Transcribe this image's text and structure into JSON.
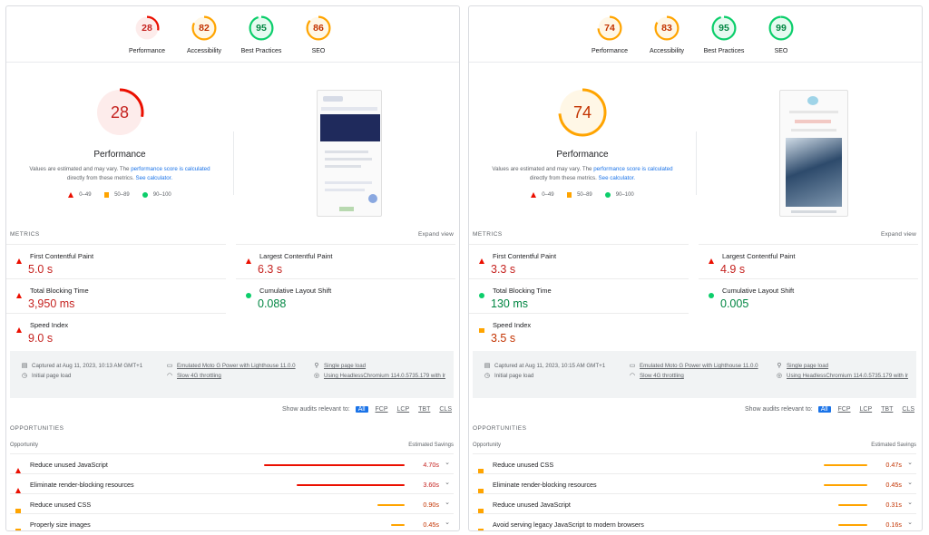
{
  "panels": [
    {
      "gauges": [
        {
          "label": "Performance",
          "score": "28",
          "value": 28,
          "color": "#eb0f00",
          "bg": "#fdeceb",
          "text": "#c5221f"
        },
        {
          "label": "Accessibility",
          "score": "82",
          "value": 82,
          "color": "#ffa400",
          "bg": "#fff7e6",
          "text": "#c33300"
        },
        {
          "label": "Best Practices",
          "score": "95",
          "value": 95,
          "color": "#0cce6b",
          "bg": "#e6faf0",
          "text": "#018642"
        },
        {
          "label": "SEO",
          "score": "86",
          "value": 86,
          "color": "#ffa400",
          "bg": "#fff7e6",
          "text": "#c33300"
        }
      ],
      "main": {
        "score": "28",
        "value": 28,
        "color": "#eb0f00",
        "bg": "#fdeceb",
        "text": "#c5221f",
        "title": "Performance"
      },
      "metrics": [
        {
          "name": "First Contentful Paint",
          "value": "5.0 s",
          "status": "red"
        },
        {
          "name": "Largest Contentful Paint",
          "value": "6.3 s",
          "status": "red"
        },
        {
          "name": "Total Blocking Time",
          "value": "3,950 ms",
          "status": "red"
        },
        {
          "name": "Cumulative Layout Shift",
          "value": "0.088",
          "status": "green"
        },
        {
          "name": "Speed Index",
          "value": "9.0 s",
          "status": "red"
        }
      ],
      "info": {
        "captured": "Captured at Aug 11, 2023, 10:13 AM GMT+1",
        "initial": "Initial page load",
        "device": "Emulated Moto G Power with Lighthouse 11.0.0",
        "throttle": "Slow 4G throttling",
        "single": "Single page load",
        "browser": "Using HeadlessChromium 114.0.5735.179 with lr"
      },
      "opportunities": [
        {
          "name": "Reduce unused JavaScript",
          "savings": "4.70s",
          "seconds": 4.7,
          "status": "red"
        },
        {
          "name": "Eliminate render-blocking resources",
          "savings": "3.60s",
          "seconds": 3.6,
          "status": "red"
        },
        {
          "name": "Reduce unused CSS",
          "savings": "0.90s",
          "seconds": 0.9,
          "status": "orange"
        },
        {
          "name": "Properly size images",
          "savings": "0.45s",
          "seconds": 0.45,
          "status": "orange"
        }
      ]
    },
    {
      "gauges": [
        {
          "label": "Performance",
          "score": "74",
          "value": 74,
          "color": "#ffa400",
          "bg": "#fff7e6",
          "text": "#c33300"
        },
        {
          "label": "Accessibility",
          "score": "83",
          "value": 83,
          "color": "#ffa400",
          "bg": "#fff7e6",
          "text": "#c33300"
        },
        {
          "label": "Best Practices",
          "score": "95",
          "value": 95,
          "color": "#0cce6b",
          "bg": "#e6faf0",
          "text": "#018642"
        },
        {
          "label": "SEO",
          "score": "99",
          "value": 99,
          "color": "#0cce6b",
          "bg": "#e6faf0",
          "text": "#018642"
        }
      ],
      "main": {
        "score": "74",
        "value": 74,
        "color": "#ffa400",
        "bg": "#fff7e6",
        "text": "#c33300",
        "title": "Performance"
      },
      "metrics": [
        {
          "name": "First Contentful Paint",
          "value": "3.3 s",
          "status": "red"
        },
        {
          "name": "Largest Contentful Paint",
          "value": "4.9 s",
          "status": "red"
        },
        {
          "name": "Total Blocking Time",
          "value": "130 ms",
          "status": "green"
        },
        {
          "name": "Cumulative Layout Shift",
          "value": "0.005",
          "status": "green"
        },
        {
          "name": "Speed Index",
          "value": "3.5 s",
          "status": "orange"
        }
      ],
      "info": {
        "captured": "Captured at Aug 11, 2023, 10:15 AM GMT+1",
        "initial": "Initial page load",
        "device": "Emulated Moto G Power with Lighthouse 11.0.0",
        "throttle": "Slow 4G throttling",
        "single": "Single page load",
        "browser": "Using HeadlessChromium 114.0.5735.179 with lr"
      },
      "opportunities": [
        {
          "name": "Reduce unused CSS",
          "savings": "0.47s",
          "seconds": 0.47,
          "status": "orange"
        },
        {
          "name": "Eliminate render-blocking resources",
          "savings": "0.45s",
          "seconds": 0.45,
          "status": "orange"
        },
        {
          "name": "Reduce unused JavaScript",
          "savings": "0.31s",
          "seconds": 0.31,
          "status": "orange"
        },
        {
          "name": "Avoid serving legacy JavaScript to modern browsers",
          "savings": "0.16s",
          "seconds": 0.16,
          "status": "orange"
        }
      ]
    }
  ],
  "common": {
    "desc_prefix": "Values are estimated and may vary. The ",
    "desc_link1": "performance score is calculated",
    "desc_mid": "directly from these metrics. ",
    "desc_link2": "See calculator.",
    "legend": [
      "0–49",
      "50–89",
      "90–100"
    ],
    "metrics_heading": "METRICS",
    "expand_view": "Expand view",
    "show_audits": "Show audits relevant to:",
    "filters": [
      "All",
      "FCP",
      "LCP",
      "TBT",
      "CLS"
    ],
    "opportunities_heading": "OPPORTUNITIES",
    "col_opportunity": "Opportunity",
    "col_savings": "Estimated Savings"
  },
  "colors": {
    "red": "#eb0f00",
    "orange": "#ffa400",
    "green": "#0cce6b",
    "link": "#1a73e8"
  }
}
